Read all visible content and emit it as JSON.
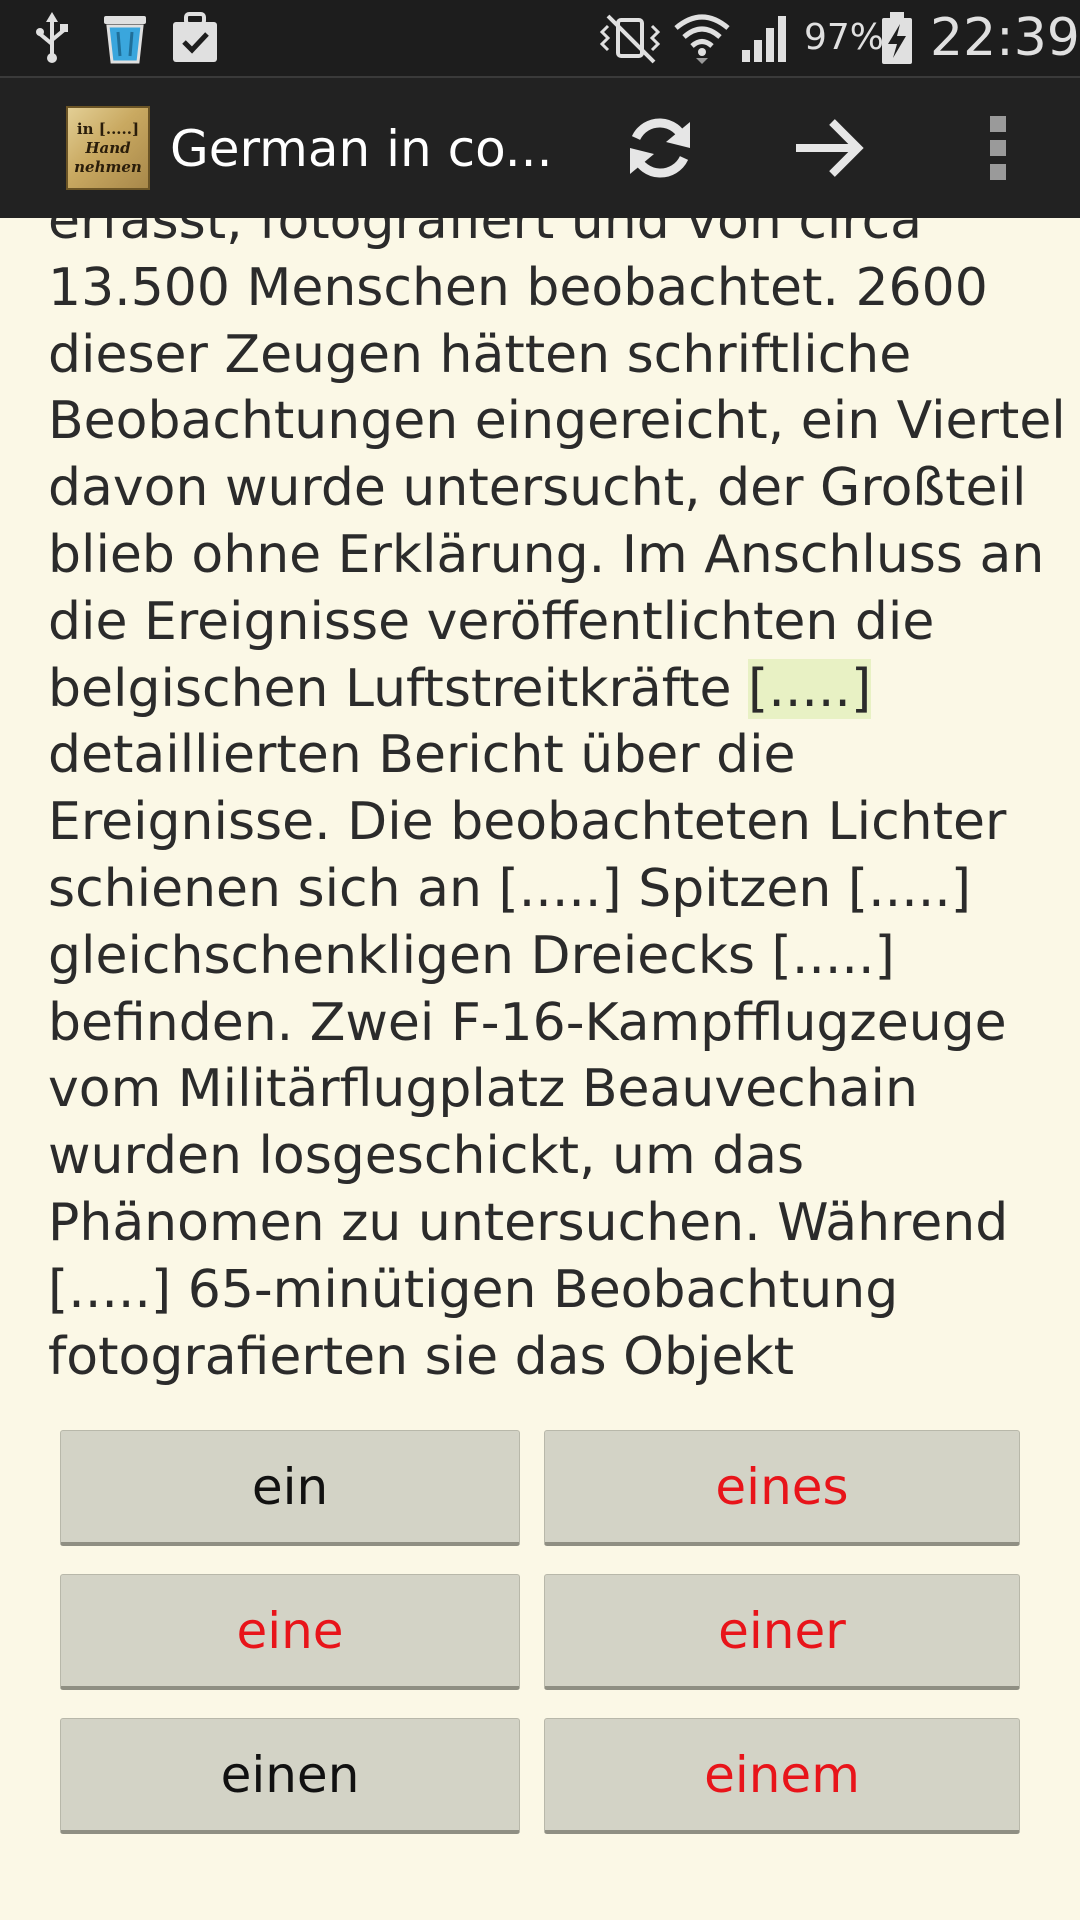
{
  "status_bar": {
    "battery_percent": "97%",
    "time": "22:39",
    "left_icons": [
      "usb-icon",
      "trash-icon",
      "clipboard-check-icon"
    ],
    "right_icons": [
      "vibrate-mute-icon",
      "wifi-icon",
      "signal-icon",
      "battery-charging-icon"
    ]
  },
  "action_bar": {
    "logo_lines": [
      "in [.....]",
      "Hand",
      "nehmen"
    ],
    "title": "German in co...",
    "actions": [
      "refresh-icon",
      "arrow-right-icon",
      "overflow-menu-icon"
    ]
  },
  "passage": {
    "lines": [
      "erfasst, fotografiert und von circa",
      "13.500 Menschen beobachtet. 2600",
      "dieser Zeugen hätten schriftliche",
      "Beobachtungen eingereicht, ein Viertel",
      "davon wurde untersucht, der Großteil",
      "blieb ohne Erklärung. Im Anschluss an",
      "die Ereignisse veröffentlichten die",
      "belgischen Luftstreitkräfte ",
      "detaillierten Bericht über die",
      "Ereignisse. Die beobachteten Lichter",
      "schienen sich an [.....] Spitzen [.....]",
      "gleichschenkligen Dreiecks [.....]",
      "befinden. Zwei F-16-Kampfflugzeuge",
      "vom Militärflugplatz Beauvechain",
      "wurden losgeschickt, um das",
      "Phänomen zu untersuchen. Während",
      "[.....] 65-minütigen Beobachtung",
      "fotografierten sie das Objekt"
    ],
    "active_gap": "[.....]"
  },
  "answers": [
    {
      "label": "ein",
      "color": "#111111"
    },
    {
      "label": "eines",
      "color": "#e8141a"
    },
    {
      "label": "eine",
      "color": "#e8141a"
    },
    {
      "label": "einer",
      "color": "#e8141a"
    },
    {
      "label": "einen",
      "color": "#111111"
    },
    {
      "label": "einem",
      "color": "#e8141a"
    }
  ],
  "colors": {
    "background": "#fbf8e6",
    "action_bar": "#222222",
    "status_bar": "#1d1d1d",
    "button": "#d3d3c6",
    "active_gap_highlight": "#e8f1c4",
    "wrong_answer": "#e8141a"
  }
}
